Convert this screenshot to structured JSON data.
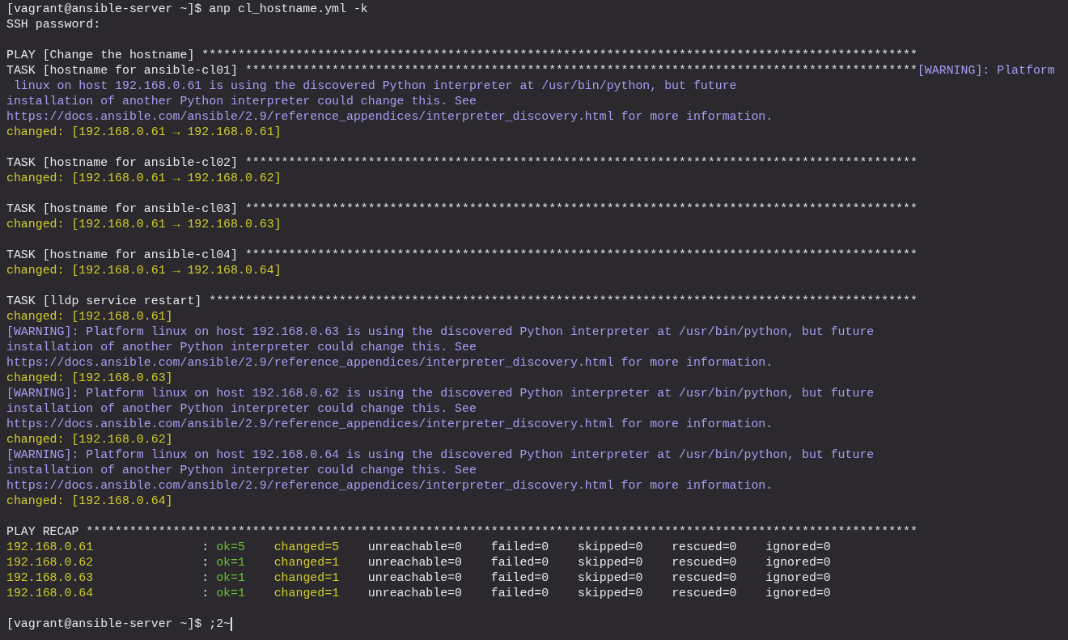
{
  "terminal": {
    "lines": [
      {
        "kind": "text",
        "segments": [
          {
            "text": "[vagrant@ansible-server ~]$ anp cl_hostname.yml -k",
            "kind": "plain"
          }
        ]
      },
      {
        "kind": "text",
        "segments": [
          {
            "text": "SSH password:",
            "kind": "plain"
          }
        ]
      },
      {
        "kind": "blank"
      },
      {
        "kind": "text",
        "segments": [
          {
            "text": "PLAY [Change the hostname] ***************************************************************************************************",
            "kind": "plain"
          }
        ]
      },
      {
        "kind": "text",
        "segments": [
          {
            "text": "TASK [hostname for ansible-cl01] *********************************************************************************************",
            "kind": "plain"
          },
          {
            "text": "[WARNING]: Platform",
            "kind": "warning"
          }
        ]
      },
      {
        "kind": "text",
        "segments": [
          {
            "text": " linux on host 192.168.0.61 is using the discovered Python interpreter at /usr/bin/python, but future",
            "kind": "warning"
          }
        ]
      },
      {
        "kind": "text",
        "segments": [
          {
            "text": "installation of another Python interpreter could change this. See",
            "kind": "warning"
          }
        ]
      },
      {
        "kind": "text",
        "segments": [
          {
            "text": "https://docs.ansible.com/ansible/2.9/reference_appendices/interpreter_discovery.html for more information.",
            "kind": "warning"
          }
        ]
      },
      {
        "kind": "text",
        "segments": [
          {
            "text": "changed: [192.168.0.61 → 192.168.0.61]",
            "kind": "changed"
          }
        ]
      },
      {
        "kind": "blank"
      },
      {
        "kind": "text",
        "segments": [
          {
            "text": "TASK [hostname for ansible-cl02] *********************************************************************************************",
            "kind": "plain"
          }
        ]
      },
      {
        "kind": "text",
        "segments": [
          {
            "text": "changed: [192.168.0.61 → 192.168.0.62]",
            "kind": "changed"
          }
        ]
      },
      {
        "kind": "blank"
      },
      {
        "kind": "text",
        "segments": [
          {
            "text": "TASK [hostname for ansible-cl03] *********************************************************************************************",
            "kind": "plain"
          }
        ]
      },
      {
        "kind": "text",
        "segments": [
          {
            "text": "changed: [192.168.0.61 → 192.168.0.63]",
            "kind": "changed"
          }
        ]
      },
      {
        "kind": "blank"
      },
      {
        "kind": "text",
        "segments": [
          {
            "text": "TASK [hostname for ansible-cl04] *********************************************************************************************",
            "kind": "plain"
          }
        ]
      },
      {
        "kind": "text",
        "segments": [
          {
            "text": "changed: [192.168.0.61 → 192.168.0.64]",
            "kind": "changed"
          }
        ]
      },
      {
        "kind": "blank"
      },
      {
        "kind": "text",
        "segments": [
          {
            "text": "TASK [lldp service restart] **************************************************************************************************",
            "kind": "plain"
          }
        ]
      },
      {
        "kind": "text",
        "segments": [
          {
            "text": "changed: [192.168.0.61]",
            "kind": "changed"
          }
        ]
      },
      {
        "kind": "text",
        "segments": [
          {
            "text": "[WARNING]: Platform linux on host 192.168.0.63 is using the discovered Python interpreter at /usr/bin/python, but future",
            "kind": "warning"
          }
        ]
      },
      {
        "kind": "text",
        "segments": [
          {
            "text": "installation of another Python interpreter could change this. See",
            "kind": "warning"
          }
        ]
      },
      {
        "kind": "text",
        "segments": [
          {
            "text": "https://docs.ansible.com/ansible/2.9/reference_appendices/interpreter_discovery.html for more information.",
            "kind": "warning"
          }
        ]
      },
      {
        "kind": "text",
        "segments": [
          {
            "text": "changed: [192.168.0.63]",
            "kind": "changed"
          }
        ]
      },
      {
        "kind": "text",
        "segments": [
          {
            "text": "[WARNING]: Platform linux on host 192.168.0.62 is using the discovered Python interpreter at /usr/bin/python, but future",
            "kind": "warning"
          }
        ]
      },
      {
        "kind": "text",
        "segments": [
          {
            "text": "installation of another Python interpreter could change this. See",
            "kind": "warning"
          }
        ]
      },
      {
        "kind": "text",
        "segments": [
          {
            "text": "https://docs.ansible.com/ansible/2.9/reference_appendices/interpreter_discovery.html for more information.",
            "kind": "warning"
          }
        ]
      },
      {
        "kind": "text",
        "segments": [
          {
            "text": "changed: [192.168.0.62]",
            "kind": "changed"
          }
        ]
      },
      {
        "kind": "text",
        "segments": [
          {
            "text": "[WARNING]: Platform linux on host 192.168.0.64 is using the discovered Python interpreter at /usr/bin/python, but future",
            "kind": "warning"
          }
        ]
      },
      {
        "kind": "text",
        "segments": [
          {
            "text": "installation of another Python interpreter could change this. See",
            "kind": "warning"
          }
        ]
      },
      {
        "kind": "text",
        "segments": [
          {
            "text": "https://docs.ansible.com/ansible/2.9/reference_appendices/interpreter_discovery.html for more information.",
            "kind": "warning"
          }
        ]
      },
      {
        "kind": "text",
        "segments": [
          {
            "text": "changed: [192.168.0.64]",
            "kind": "changed"
          }
        ]
      },
      {
        "kind": "blank"
      },
      {
        "kind": "text",
        "segments": [
          {
            "text": "PLAY RECAP *******************************************************************************************************************",
            "kind": "plain"
          }
        ]
      },
      {
        "kind": "text",
        "segments": [
          {
            "text": "192.168.0.61               ",
            "kind": "changed"
          },
          {
            "text": ": ",
            "kind": "plain"
          },
          {
            "text": "ok=5    ",
            "kind": "ok"
          },
          {
            "text": "changed=5    ",
            "kind": "changed"
          },
          {
            "text": "unreachable=0    failed=0    skipped=0    rescued=0    ignored=0",
            "kind": "plain"
          }
        ]
      },
      {
        "kind": "text",
        "segments": [
          {
            "text": "192.168.0.62               ",
            "kind": "changed"
          },
          {
            "text": ": ",
            "kind": "plain"
          },
          {
            "text": "ok=1    ",
            "kind": "ok"
          },
          {
            "text": "changed=1    ",
            "kind": "changed"
          },
          {
            "text": "unreachable=0    failed=0    skipped=0    rescued=0    ignored=0",
            "kind": "plain"
          }
        ]
      },
      {
        "kind": "text",
        "segments": [
          {
            "text": "192.168.0.63               ",
            "kind": "changed"
          },
          {
            "text": ": ",
            "kind": "plain"
          },
          {
            "text": "ok=1    ",
            "kind": "ok"
          },
          {
            "text": "changed=1    ",
            "kind": "changed"
          },
          {
            "text": "unreachable=0    failed=0    skipped=0    rescued=0    ignored=0",
            "kind": "plain"
          }
        ]
      },
      {
        "kind": "text",
        "segments": [
          {
            "text": "192.168.0.64               ",
            "kind": "changed"
          },
          {
            "text": ": ",
            "kind": "plain"
          },
          {
            "text": "ok=1    ",
            "kind": "ok"
          },
          {
            "text": "changed=1    ",
            "kind": "changed"
          },
          {
            "text": "unreachable=0    failed=0    skipped=0    rescued=0    ignored=0",
            "kind": "plain"
          }
        ]
      },
      {
        "kind": "blank"
      },
      {
        "kind": "text",
        "cursor": true,
        "segments": [
          {
            "text": "[vagrant@ansible-server ~]$ ;2~",
            "kind": "plain"
          }
        ]
      }
    ]
  }
}
